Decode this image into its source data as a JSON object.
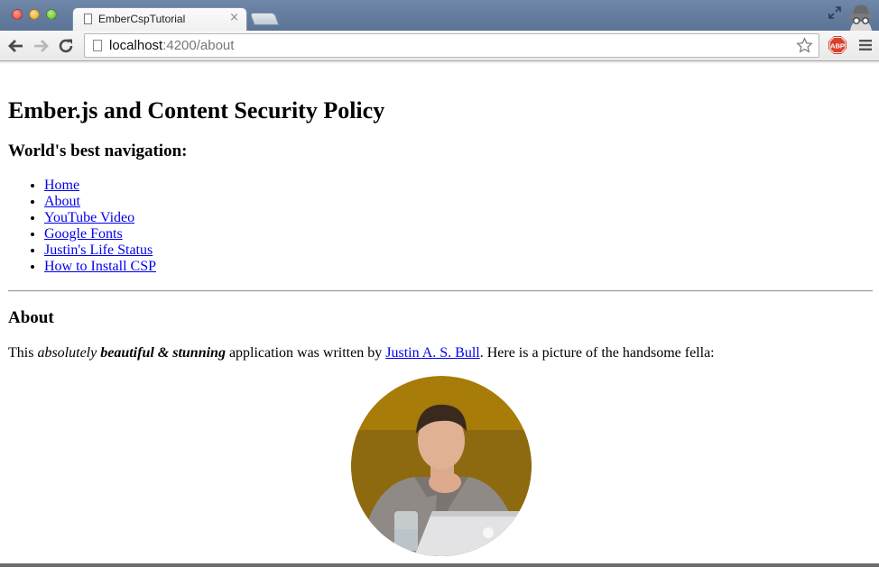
{
  "browser": {
    "tab": {
      "title": "EmberCspTutorial",
      "close_glyph": "×"
    },
    "address": {
      "host": "localhost",
      "rest": ":4200/about"
    },
    "icons": {
      "back": "back-arrow-icon",
      "forward": "forward-arrow-icon",
      "reload": "reload-icon",
      "bookmark": "star-icon",
      "adblock": "adblock-plus-icon",
      "adblock_text": "ABP",
      "menu": "hamburger-menu-icon",
      "fullscreen": "fullscreen-icon",
      "incognito": "incognito-icon"
    }
  },
  "page": {
    "title": "Ember.js and Content Security Policy",
    "nav_heading": "World's best navigation:",
    "nav_items": [
      {
        "label": "Home"
      },
      {
        "label": "About"
      },
      {
        "label": "YouTube Video"
      },
      {
        "label": "Google Fonts"
      },
      {
        "label": "Justin's Life Status"
      },
      {
        "label": "How to Install CSP"
      }
    ],
    "about": {
      "heading": "About",
      "intro_prefix": "This ",
      "intro_absolutely": "absolutely",
      "intro_space": " ",
      "intro_beautiful": "beautiful & stunning",
      "intro_middle": " application was written by ",
      "author_link": "Justin A. S. Bull",
      "intro_suffix": ". Here is a picture of the handsome fella:"
    },
    "photo": {
      "description_icon": "profile-photo"
    }
  },
  "colors": {
    "titlebar": "#5f789b",
    "link": "#0000ee",
    "photo_background": "#a87c09"
  }
}
